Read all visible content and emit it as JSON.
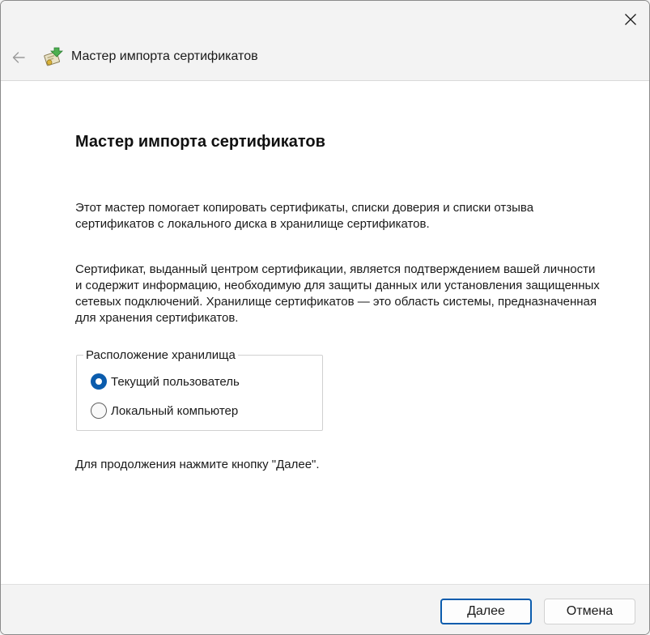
{
  "window": {
    "title": "Мастер импорта сертификатов",
    "accent_color": "#0b5cad"
  },
  "header": {
    "back_icon": "arrow-left-icon",
    "wizard_icon": "certificate-import-icon",
    "title": "Мастер импорта сертификатов",
    "close_icon": "close-icon"
  },
  "main": {
    "heading": "Мастер импорта сертификатов",
    "intro": "Этот мастер помогает копировать сертификаты, списки доверия и списки отзыва сертификатов с локального диска в хранилище сертификатов.",
    "description": "Сертификат, выданный центром сертификации, является подтверждением вашей личности и содержит информацию, необходимую для защиты данных или установления защищенных сетевых подключений. Хранилище сертификатов — это область системы, предназначенная для хранения сертификатов.",
    "store_location": {
      "legend": "Расположение хранилища",
      "options": [
        {
          "label": "Текущий пользователь",
          "selected": true
        },
        {
          "label": "Локальный компьютер",
          "selected": false
        }
      ]
    },
    "continue_hint": "Для продолжения нажмите кнопку \"Далее\"."
  },
  "footer": {
    "next_label": "Далее",
    "cancel_label": "Отмена"
  }
}
